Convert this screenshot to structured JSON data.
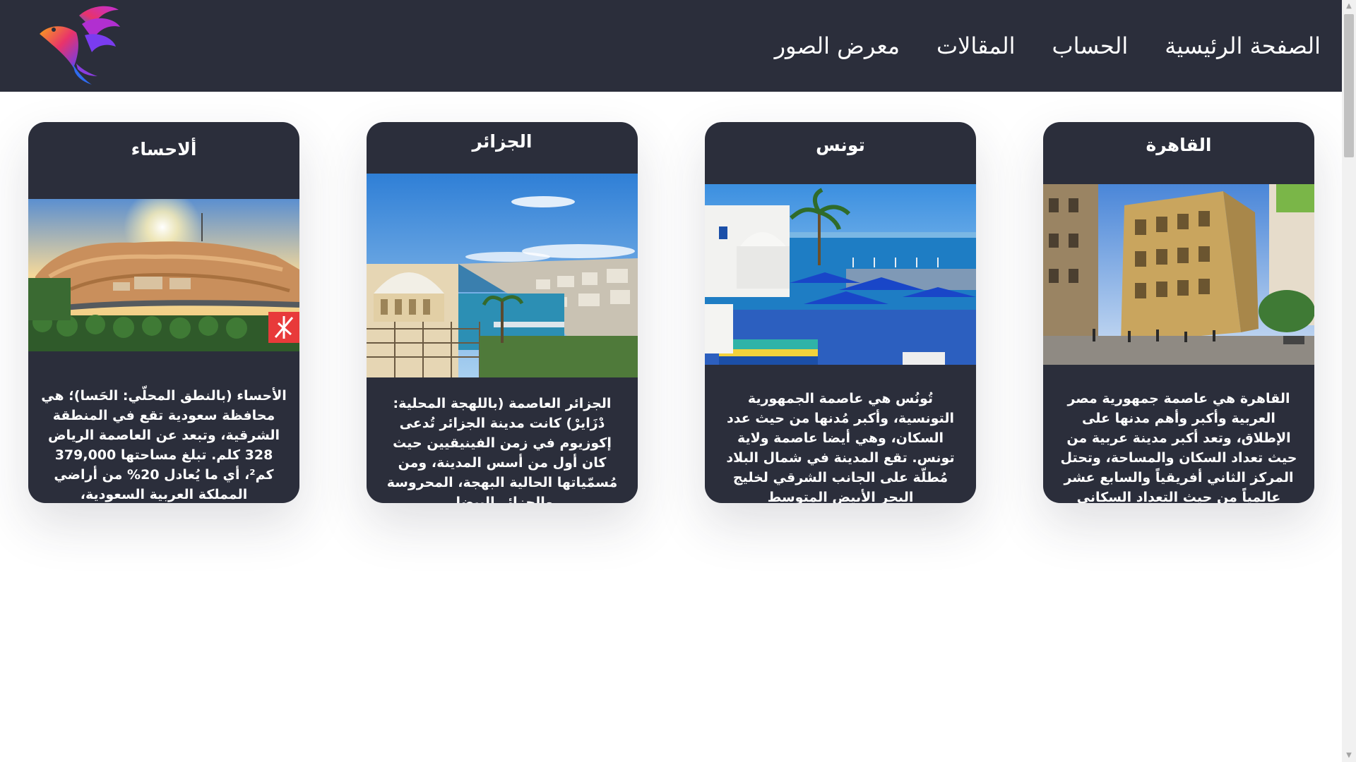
{
  "nav": {
    "links": [
      "الصفحة الرئيسية",
      "الحساب",
      "المقالات",
      "معرض الصور"
    ]
  },
  "colors": {
    "navbar_bg": "#2b2e3b",
    "card_bg": "#2b2e3b",
    "page_bg": "#ffffff",
    "text": "#ffffff"
  },
  "icons": {
    "logo": "phoenix-bird-logo",
    "scroll_up": "triangle-up",
    "scroll_down": "triangle-down"
  },
  "cards": [
    {
      "title": "القاهرة",
      "image": "cairo-street-buildings-photo",
      "text": "القاهرة هي عاصمة جمهورية مصر العربية وأكبر وأهم مدنها على الإطلاق، وتعد أكبر مدينة عربية من حيث تعداد السكان والمساحة، وتحتل المركز الثاني أفريقياً والسابع عشر عالمياً من حيث التعداد السكاني"
    },
    {
      "title": "تونس",
      "image": "tunis-sidi-bou-said-harbor-photo",
      "text": "تُونُس هي عاصمة الجمهورية التونسية، وأكبر مُدنها من حيث عدد السكان، وهي أيضا عاصمة ولاية تونس. تقع المدينة في شمال البلاد مُطلّة على الجانب الشرقي لخليج البحر الأبيض المتوسط"
    },
    {
      "title": "الجزائر",
      "image": "algiers-coastline-dome-photo",
      "text": "الجزائر العاصمة (باللهجة المحلية: دْزَايرْ) كانت مدينة الجزائر تُدعى إكوزيوم في زمن الفينيقيين حيث كان أول من أسس المدينة، ومن مُسمّياتها الحالية البهجة، المحروسة والجزائر البيضا."
    },
    {
      "title": "ألاحساء",
      "image": "al-ahsa-mountain-oasis-photo",
      "text": "الأحساء (بالنطق المحلّي: الحَسا)؛ هي محافظة سعودية تقع في المنطقة الشرقية، وتبعد عن العاصمة الرياض 328 كلم. تبلغ مساحتها 379,000 كم²، أي ما يُعادل 20% من أراضي المملكة العربية السعودية،"
    }
  ]
}
